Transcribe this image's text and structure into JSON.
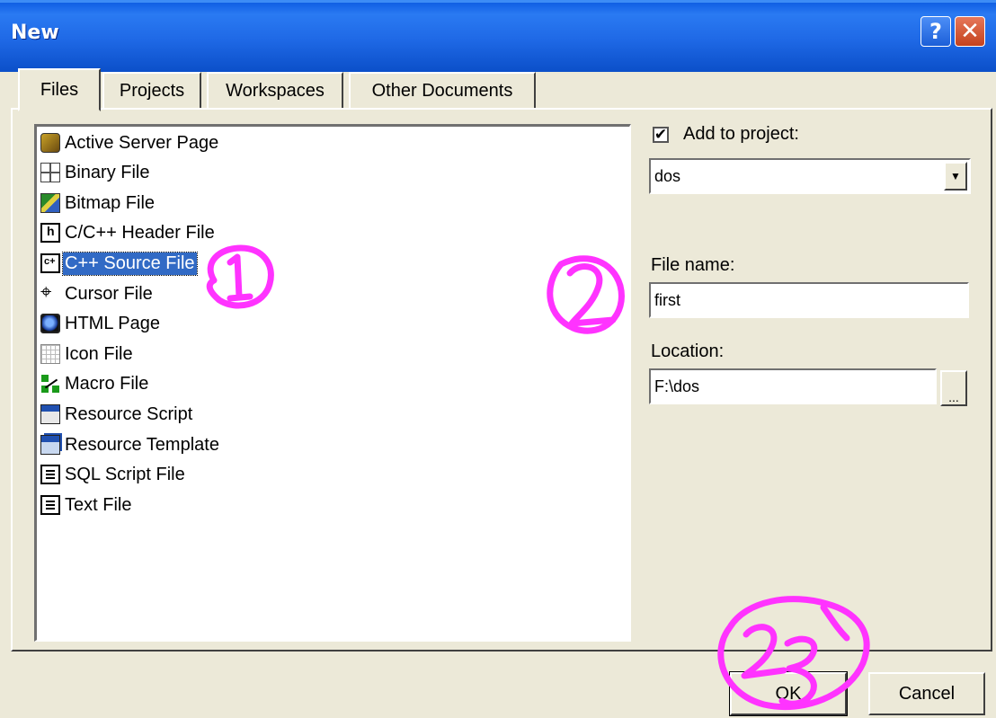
{
  "window": {
    "title": "New",
    "help_glyph": "?",
    "close_glyph": "✕"
  },
  "tabs": [
    {
      "label": "Files",
      "active": true
    },
    {
      "label": "Projects",
      "active": false
    },
    {
      "label": "Workspaces",
      "active": false
    },
    {
      "label": "Other Documents",
      "active": false
    }
  ],
  "file_types": [
    {
      "label": "Active Server Page",
      "icon": "asp-icon"
    },
    {
      "label": "Binary File",
      "icon": "binary-file-icon"
    },
    {
      "label": "Bitmap File",
      "icon": "bitmap-file-icon"
    },
    {
      "label": "C/C++ Header File",
      "icon": "header-file-icon"
    },
    {
      "label": "C++ Source File",
      "icon": "cpp-source-icon",
      "selected": true
    },
    {
      "label": "Cursor File",
      "icon": "cursor-file-icon"
    },
    {
      "label": "HTML Page",
      "icon": "html-page-icon"
    },
    {
      "label": "Icon File",
      "icon": "icon-file-icon"
    },
    {
      "label": "Macro File",
      "icon": "macro-file-icon"
    },
    {
      "label": "Resource Script",
      "icon": "resource-script-icon"
    },
    {
      "label": "Resource Template",
      "icon": "resource-template-icon"
    },
    {
      "label": "SQL Script File",
      "icon": "sql-script-icon"
    },
    {
      "label": "Text File",
      "icon": "text-file-icon"
    }
  ],
  "add_to_project": {
    "checked": true,
    "check_glyph": "✔",
    "label": "Add to project:",
    "project_value": "dos",
    "dropdown_glyph": "▼"
  },
  "file_name": {
    "label": "File name:",
    "value": "first"
  },
  "location": {
    "label": "Location:",
    "value": "F:\\dos",
    "browse_label": "..."
  },
  "buttons": {
    "ok": "OK",
    "cancel": "Cancel"
  },
  "annotations": {
    "color": "#ff33ff",
    "marks": [
      "1",
      "2",
      "3"
    ]
  }
}
